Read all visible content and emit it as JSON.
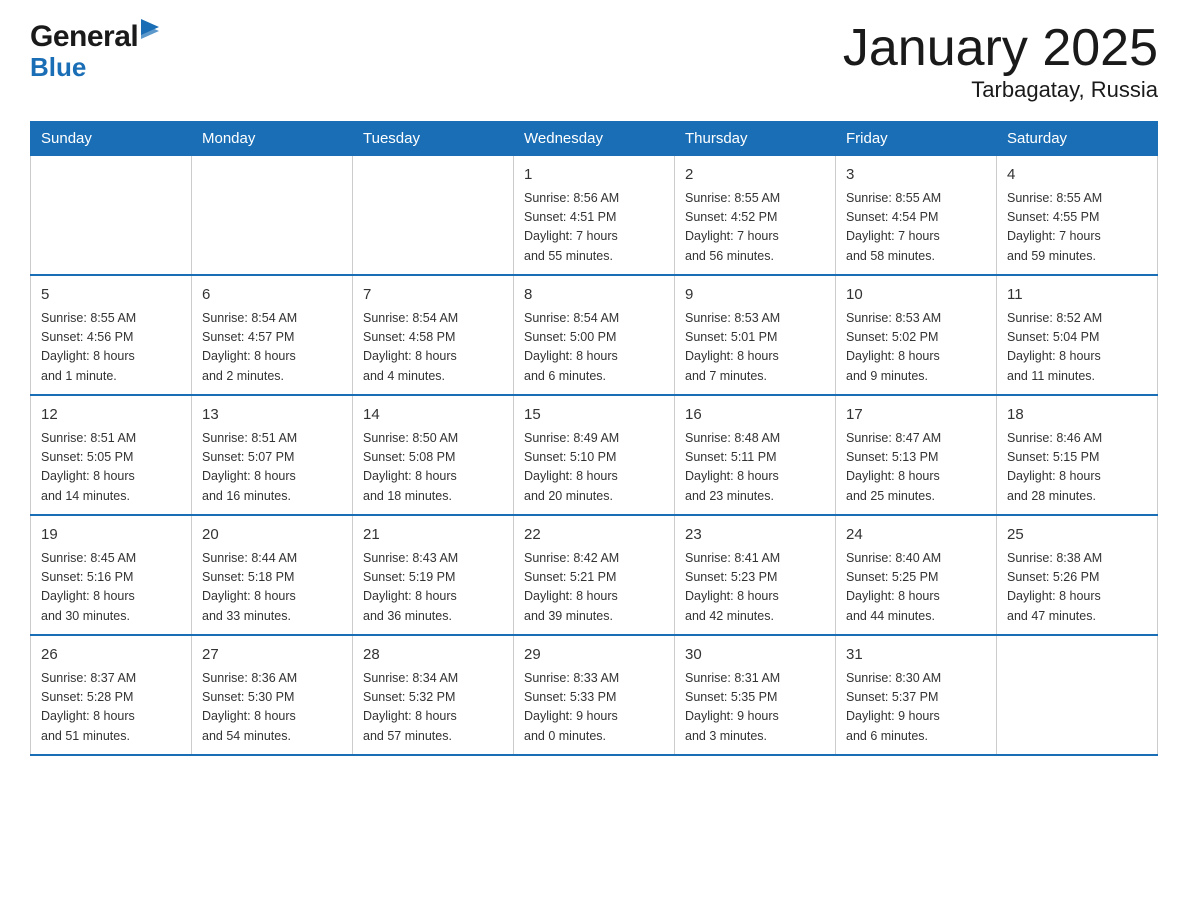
{
  "header": {
    "logo_general": "General",
    "logo_blue": "Blue",
    "title": "January 2025",
    "subtitle": "Tarbagatay, Russia"
  },
  "calendar": {
    "days_of_week": [
      "Sunday",
      "Monday",
      "Tuesday",
      "Wednesday",
      "Thursday",
      "Friday",
      "Saturday"
    ],
    "weeks": [
      [
        {
          "day": "",
          "info": ""
        },
        {
          "day": "",
          "info": ""
        },
        {
          "day": "",
          "info": ""
        },
        {
          "day": "1",
          "info": "Sunrise: 8:56 AM\nSunset: 4:51 PM\nDaylight: 7 hours\nand 55 minutes."
        },
        {
          "day": "2",
          "info": "Sunrise: 8:55 AM\nSunset: 4:52 PM\nDaylight: 7 hours\nand 56 minutes."
        },
        {
          "day": "3",
          "info": "Sunrise: 8:55 AM\nSunset: 4:54 PM\nDaylight: 7 hours\nand 58 minutes."
        },
        {
          "day": "4",
          "info": "Sunrise: 8:55 AM\nSunset: 4:55 PM\nDaylight: 7 hours\nand 59 minutes."
        }
      ],
      [
        {
          "day": "5",
          "info": "Sunrise: 8:55 AM\nSunset: 4:56 PM\nDaylight: 8 hours\nand 1 minute."
        },
        {
          "day": "6",
          "info": "Sunrise: 8:54 AM\nSunset: 4:57 PM\nDaylight: 8 hours\nand 2 minutes."
        },
        {
          "day": "7",
          "info": "Sunrise: 8:54 AM\nSunset: 4:58 PM\nDaylight: 8 hours\nand 4 minutes."
        },
        {
          "day": "8",
          "info": "Sunrise: 8:54 AM\nSunset: 5:00 PM\nDaylight: 8 hours\nand 6 minutes."
        },
        {
          "day": "9",
          "info": "Sunrise: 8:53 AM\nSunset: 5:01 PM\nDaylight: 8 hours\nand 7 minutes."
        },
        {
          "day": "10",
          "info": "Sunrise: 8:53 AM\nSunset: 5:02 PM\nDaylight: 8 hours\nand 9 minutes."
        },
        {
          "day": "11",
          "info": "Sunrise: 8:52 AM\nSunset: 5:04 PM\nDaylight: 8 hours\nand 11 minutes."
        }
      ],
      [
        {
          "day": "12",
          "info": "Sunrise: 8:51 AM\nSunset: 5:05 PM\nDaylight: 8 hours\nand 14 minutes."
        },
        {
          "day": "13",
          "info": "Sunrise: 8:51 AM\nSunset: 5:07 PM\nDaylight: 8 hours\nand 16 minutes."
        },
        {
          "day": "14",
          "info": "Sunrise: 8:50 AM\nSunset: 5:08 PM\nDaylight: 8 hours\nand 18 minutes."
        },
        {
          "day": "15",
          "info": "Sunrise: 8:49 AM\nSunset: 5:10 PM\nDaylight: 8 hours\nand 20 minutes."
        },
        {
          "day": "16",
          "info": "Sunrise: 8:48 AM\nSunset: 5:11 PM\nDaylight: 8 hours\nand 23 minutes."
        },
        {
          "day": "17",
          "info": "Sunrise: 8:47 AM\nSunset: 5:13 PM\nDaylight: 8 hours\nand 25 minutes."
        },
        {
          "day": "18",
          "info": "Sunrise: 8:46 AM\nSunset: 5:15 PM\nDaylight: 8 hours\nand 28 minutes."
        }
      ],
      [
        {
          "day": "19",
          "info": "Sunrise: 8:45 AM\nSunset: 5:16 PM\nDaylight: 8 hours\nand 30 minutes."
        },
        {
          "day": "20",
          "info": "Sunrise: 8:44 AM\nSunset: 5:18 PM\nDaylight: 8 hours\nand 33 minutes."
        },
        {
          "day": "21",
          "info": "Sunrise: 8:43 AM\nSunset: 5:19 PM\nDaylight: 8 hours\nand 36 minutes."
        },
        {
          "day": "22",
          "info": "Sunrise: 8:42 AM\nSunset: 5:21 PM\nDaylight: 8 hours\nand 39 minutes."
        },
        {
          "day": "23",
          "info": "Sunrise: 8:41 AM\nSunset: 5:23 PM\nDaylight: 8 hours\nand 42 minutes."
        },
        {
          "day": "24",
          "info": "Sunrise: 8:40 AM\nSunset: 5:25 PM\nDaylight: 8 hours\nand 44 minutes."
        },
        {
          "day": "25",
          "info": "Sunrise: 8:38 AM\nSunset: 5:26 PM\nDaylight: 8 hours\nand 47 minutes."
        }
      ],
      [
        {
          "day": "26",
          "info": "Sunrise: 8:37 AM\nSunset: 5:28 PM\nDaylight: 8 hours\nand 51 minutes."
        },
        {
          "day": "27",
          "info": "Sunrise: 8:36 AM\nSunset: 5:30 PM\nDaylight: 8 hours\nand 54 minutes."
        },
        {
          "day": "28",
          "info": "Sunrise: 8:34 AM\nSunset: 5:32 PM\nDaylight: 8 hours\nand 57 minutes."
        },
        {
          "day": "29",
          "info": "Sunrise: 8:33 AM\nSunset: 5:33 PM\nDaylight: 9 hours\nand 0 minutes."
        },
        {
          "day": "30",
          "info": "Sunrise: 8:31 AM\nSunset: 5:35 PM\nDaylight: 9 hours\nand 3 minutes."
        },
        {
          "day": "31",
          "info": "Sunrise: 8:30 AM\nSunset: 5:37 PM\nDaylight: 9 hours\nand 6 minutes."
        },
        {
          "day": "",
          "info": ""
        }
      ]
    ]
  }
}
